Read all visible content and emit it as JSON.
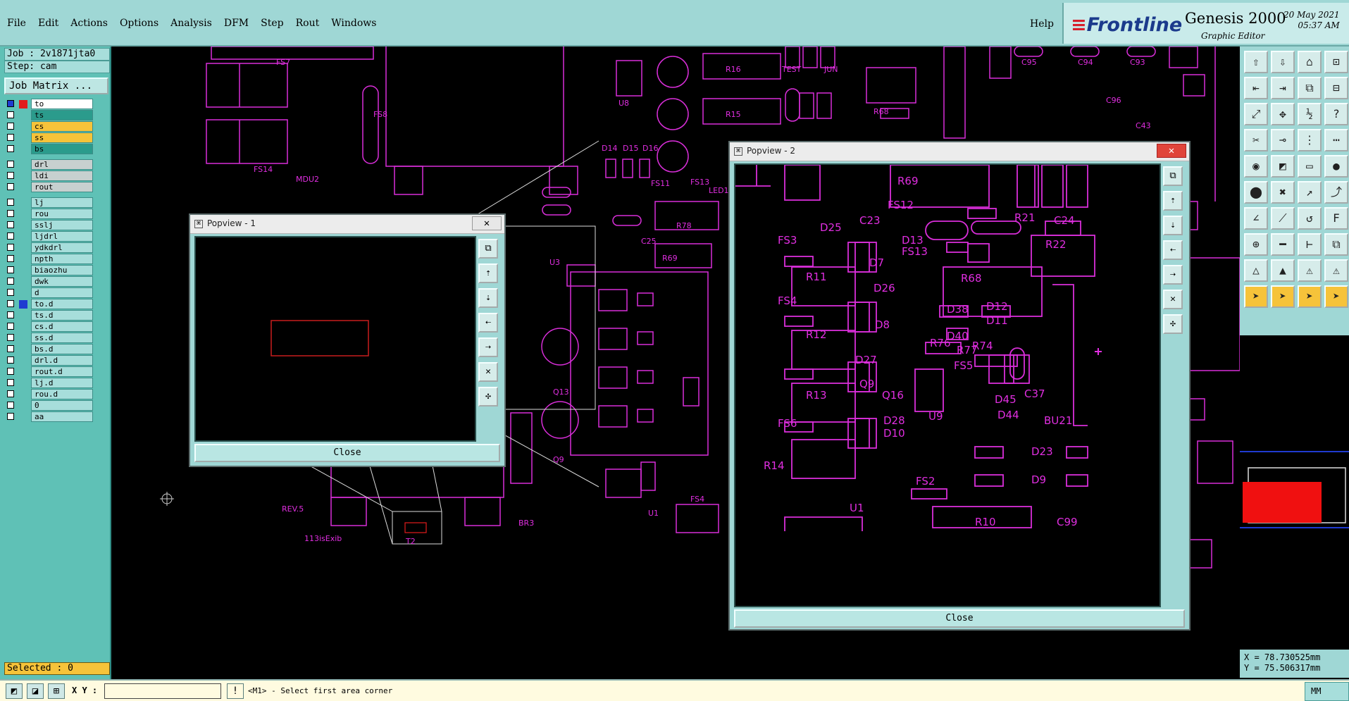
{
  "menubar": {
    "items": [
      "File",
      "Edit",
      "Actions",
      "Options",
      "Analysis",
      "DFM",
      "Step",
      "Rout",
      "Windows"
    ],
    "help": "Help"
  },
  "brand": {
    "logo": "Frontline",
    "product": "Genesis 2000",
    "subtitle": "Graphic Editor",
    "date": "20 May 2021",
    "time": "05:37 AM"
  },
  "left": {
    "job": "Job : 2v1871jta0",
    "step": "Step: cam",
    "job_matrix": "Job Matrix ...",
    "selected": "Selected : 0",
    "layers": [
      {
        "name": "to",
        "style": "white",
        "swatch": "#e21c1c",
        "checked": true
      },
      {
        "name": "ts",
        "style": "green",
        "swatch": "",
        "checked": false
      },
      {
        "name": "cs",
        "style": "yellow",
        "swatch": "",
        "checked": false
      },
      {
        "name": "ss",
        "style": "yellow",
        "swatch": "",
        "checked": false
      },
      {
        "name": "bs",
        "style": "green",
        "swatch": "",
        "checked": false
      },
      {
        "name": "drl",
        "style": "gray",
        "swatch": "",
        "checked": false,
        "gap": true
      },
      {
        "name": "ldi",
        "style": "gray",
        "swatch": "",
        "checked": false
      },
      {
        "name": "rout",
        "style": "gray",
        "swatch": "",
        "checked": false
      },
      {
        "name": "lj",
        "style": "",
        "swatch": "",
        "checked": false,
        "gap": true
      },
      {
        "name": "rou",
        "style": "",
        "swatch": "",
        "checked": false
      },
      {
        "name": "sslj",
        "style": "",
        "swatch": "",
        "checked": false
      },
      {
        "name": "ljdrl",
        "style": "",
        "swatch": "",
        "checked": false
      },
      {
        "name": "ydkdrl",
        "style": "",
        "swatch": "",
        "checked": false
      },
      {
        "name": "npth",
        "style": "",
        "swatch": "",
        "checked": false
      },
      {
        "name": "biaozhu",
        "style": "",
        "swatch": "",
        "checked": false
      },
      {
        "name": "dwk",
        "style": "",
        "swatch": "",
        "checked": false
      },
      {
        "name": "d",
        "style": "",
        "swatch": "",
        "checked": false
      },
      {
        "name": "to.d",
        "style": "",
        "swatch": "#1f3bd1",
        "checked": false
      },
      {
        "name": "ts.d",
        "style": "",
        "swatch": "",
        "checked": false
      },
      {
        "name": "cs.d",
        "style": "",
        "swatch": "",
        "checked": false
      },
      {
        "name": "ss.d",
        "style": "",
        "swatch": "",
        "checked": false
      },
      {
        "name": "bs.d",
        "style": "",
        "swatch": "",
        "checked": false
      },
      {
        "name": "drl.d",
        "style": "",
        "swatch": "",
        "checked": false
      },
      {
        "name": "rout.d",
        "style": "",
        "swatch": "",
        "checked": false
      },
      {
        "name": "lj.d",
        "style": "",
        "swatch": "",
        "checked": false
      },
      {
        "name": "rou.d",
        "style": "",
        "swatch": "",
        "checked": false
      },
      {
        "name": "0",
        "style": "",
        "swatch": "",
        "checked": false
      },
      {
        "name": "aa",
        "style": "",
        "swatch": "",
        "checked": false
      }
    ]
  },
  "bottombar": {
    "xy_label": "X Y :",
    "xy_value": "",
    "prompt": "<M1> - Select first area corner",
    "units": "MM"
  },
  "coords": {
    "x": "X = 78.730525mm",
    "y": "Y = 75.506317mm"
  },
  "popup1": {
    "title": "Popview - 1",
    "close_label": "Close",
    "close_x": "✕"
  },
  "popup2": {
    "title": "Popview - 2",
    "close_label": "Close",
    "close_x": "✕"
  },
  "pcb_labels": [
    "FS7",
    "FS14",
    "MDU2",
    "FS8",
    "R16",
    "R15",
    "U8",
    "D14",
    "D15",
    "D16",
    "FS11",
    "FS13",
    "TEST",
    "JUN",
    "R68",
    "C96",
    "C95",
    "C94",
    "C93",
    "C43",
    "LED1",
    "C25",
    "R78",
    "R69",
    "U3",
    "Q13",
    "Q9",
    "REV.5",
    "113isExib",
    "T2",
    "U1",
    "BR3",
    "FS4",
    "BU21",
    "R14",
    "D10",
    "D28",
    "Q16"
  ],
  "popup2_labels": [
    "R69",
    "FS12",
    "C23",
    "C24",
    "R21",
    "D25",
    "FS3",
    "D13",
    "FS13",
    "R22",
    "D7",
    "R11",
    "D26",
    "R68",
    "FS4",
    "D38",
    "D12",
    "D11",
    "R12",
    "D8",
    "D40",
    "R76",
    "FS5",
    "D27",
    "R77",
    "R74",
    "C37",
    "Q9",
    "R13",
    "Q16",
    "U9",
    "D45",
    "D44",
    "D28",
    "D10",
    "BU21",
    "FS6",
    "R14",
    "D23",
    "D9",
    "FS2",
    "U1",
    "R10",
    "C99"
  ]
}
